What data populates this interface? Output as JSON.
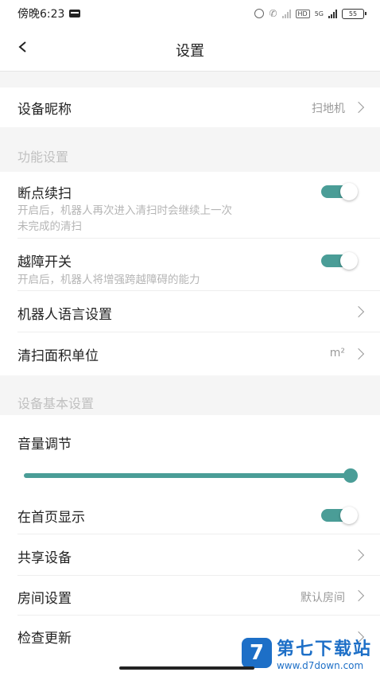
{
  "status_bar": {
    "time": "傍晚6:23",
    "network": "5G",
    "hd": "HD",
    "battery": "55"
  },
  "nav": {
    "title": "设置"
  },
  "device_nickname": {
    "label": "设备昵称",
    "value": "扫地机"
  },
  "section_function": {
    "title": "功能设置"
  },
  "breakpoint_resume": {
    "label": "断点续扫",
    "desc_line1": "开启后，机器人再次进入清扫时会继续上一次",
    "desc_line2": "未完成的清扫",
    "enabled": true
  },
  "obstacle_crossing": {
    "label": "越障开关",
    "desc": "开启后，机器人将增强跨越障碍的能力",
    "enabled": true
  },
  "robot_language": {
    "label": "机器人语言设置"
  },
  "area_unit": {
    "label": "清扫面积单位",
    "value": "m²"
  },
  "section_basic": {
    "title": "设备基本设置"
  },
  "volume": {
    "label": "音量调节",
    "level_percent": 100
  },
  "show_on_home": {
    "label": "在首页显示",
    "enabled": true
  },
  "share_device": {
    "label": "共享设备"
  },
  "room_settings": {
    "label": "房间设置",
    "value": "默认房间"
  },
  "check_update": {
    "label": "检查更新"
  },
  "watermark": {
    "logo_letter": "7",
    "title": "第七下载站",
    "url": "www.d7down.com"
  },
  "colors": {
    "accent": "#4a9d97",
    "background": "#f5f5f5"
  }
}
